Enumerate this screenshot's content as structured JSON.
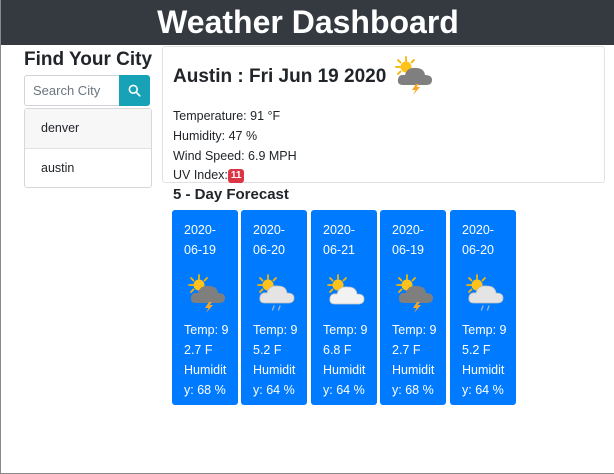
{
  "header": {
    "title": "Weather Dashboard"
  },
  "sidebar": {
    "title": "Find Your City",
    "search_placeholder": "Search City",
    "history": [
      "denver",
      "austin"
    ]
  },
  "current": {
    "city_title": "Austin : Fri Jun 19 2020",
    "icon": "thunderstorm-icon",
    "temperature": "Temperature: 91 °F",
    "humidity": "Humidity: 47 %",
    "wind": "Wind Speed: 6.9 MPH",
    "uv_label": "UV Index:",
    "uv_value": "11",
    "uv_color": "#dc3545"
  },
  "forecast": {
    "title": "5 - Day Forecast",
    "card_color": "#007bff",
    "days": [
      {
        "date": "2020-06-19",
        "icon": "thunderstorm-icon",
        "temp": "Temp: 92.7 F",
        "humidity": "Humidity: 68 %"
      },
      {
        "date": "2020-06-20",
        "icon": "partly-cloudy-rain-icon",
        "temp": "Temp: 95.2 F",
        "humidity": "Humidity: 64 %"
      },
      {
        "date": "2020-06-21",
        "icon": "partly-cloudy-icon",
        "temp": "Temp: 96.8 F",
        "humidity": "Humidity: 64 %"
      },
      {
        "date": "2020-06-19",
        "icon": "thunderstorm-icon",
        "temp": "Temp: 92.7 F",
        "humidity": "Humidity: 68 %"
      },
      {
        "date": "2020-06-20",
        "icon": "partly-cloudy-rain-icon",
        "temp": "Temp: 95.2 F",
        "humidity": "Humidity: 64 %"
      }
    ]
  }
}
